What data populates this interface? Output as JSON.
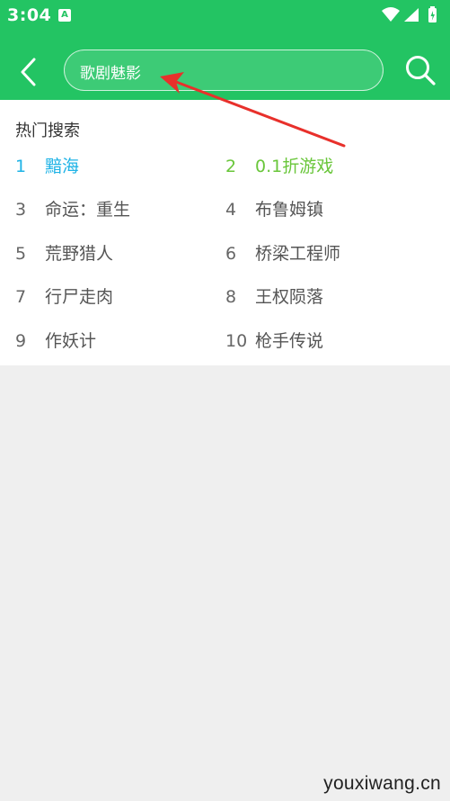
{
  "status_bar": {
    "time": "3:04",
    "notification_icon": "a-letter-icon"
  },
  "header": {
    "search_query": "歌剧魅影",
    "back_icon": "back-arrow-icon",
    "search_icon": "search-icon",
    "accent_color": "#23c463"
  },
  "hot_search": {
    "title": "热门搜索",
    "items": [
      {
        "rank": "1",
        "label": "黯海",
        "color": "#1fb3e6"
      },
      {
        "rank": "2",
        "label": "0.1折游戏",
        "color": "#69c63a"
      },
      {
        "rank": "3",
        "label": "命运：重生"
      },
      {
        "rank": "4",
        "label": "布鲁姆镇"
      },
      {
        "rank": "5",
        "label": "荒野猎人"
      },
      {
        "rank": "6",
        "label": "桥梁工程师"
      },
      {
        "rank": "7",
        "label": "行尸走肉"
      },
      {
        "rank": "8",
        "label": "王权陨落"
      },
      {
        "rank": "9",
        "label": "作妖计"
      },
      {
        "rank": "10",
        "label": "枪手传说"
      }
    ]
  },
  "watermark": "youxiwang.cn"
}
